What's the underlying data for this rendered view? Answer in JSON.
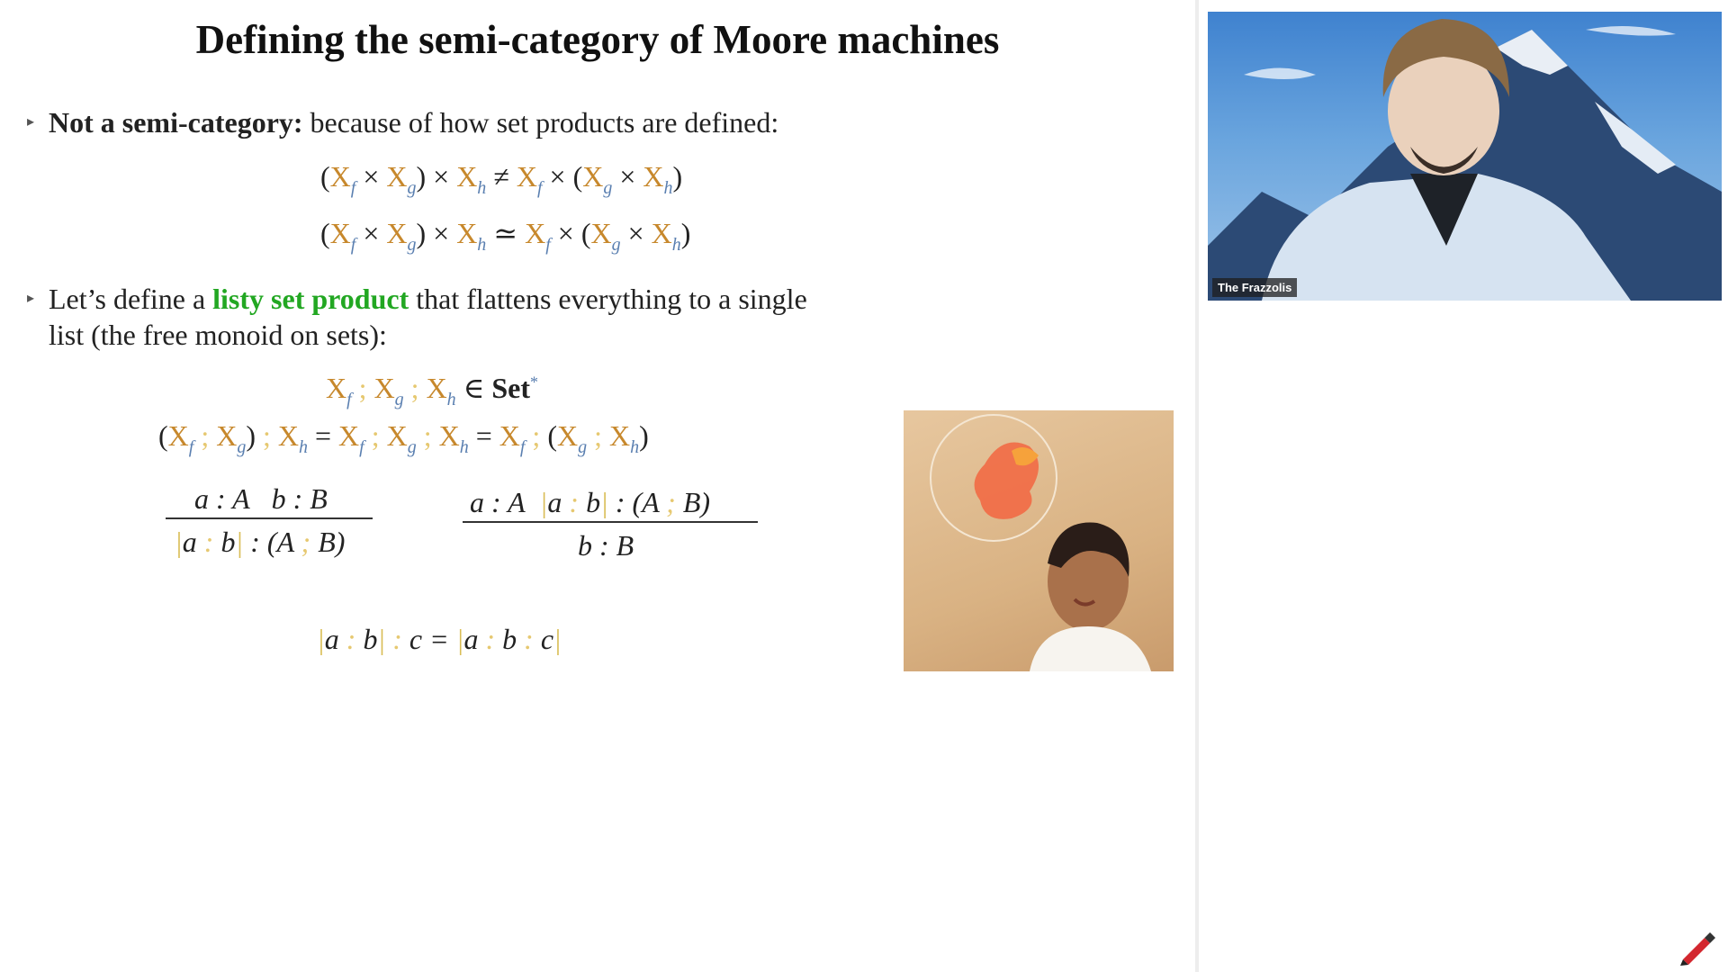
{
  "slide": {
    "title": "Defining the semi-category of Moore machines",
    "bullet1_bold": "Not a semi-category:",
    "bullet1_rest": " because of how set products are defined:",
    "bullet2_a": "Let’s define a ",
    "bullet2_green": "listy set product",
    "bullet2_b": " that flattens everything to a single",
    "bullet2_c": "list (the free monoid on sets):",
    "set_label": "Set",
    "set_star": "*"
  },
  "video": {
    "participant_name": "The Frazzolis"
  },
  "icons": {
    "bullet": "triangle-bullet",
    "toolbar_tool": "pen-tool-icon"
  },
  "colors": {
    "highlight_green": "#22a722",
    "variable_gold": "#c7882c",
    "subscript_blue": "#5a7fb0",
    "semicolon_yellow": "#e6c870"
  }
}
